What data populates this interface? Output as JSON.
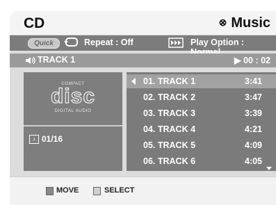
{
  "header": {
    "title": "CD",
    "mode": "Music",
    "mode_icon": "⊗"
  },
  "options": {
    "quick_label": "Quick",
    "repeat_text": "Repeat : Off",
    "play_option_text": "Play Option : Normal"
  },
  "status": {
    "current_track": "TRACK 1",
    "elapsed": "▶ 00 : 02"
  },
  "disc_logo": {
    "top": "COMPACT",
    "main": "disc",
    "bottom": "DIGITAL AUDIO"
  },
  "track_count": "01/16",
  "tracks": [
    {
      "name": "01. TRACK 1",
      "duration": "3:41"
    },
    {
      "name": "02. TRACK 2",
      "duration": "3:47"
    },
    {
      "name": "03. TRACK 3",
      "duration": "3:39"
    },
    {
      "name": "04. TRACK 4",
      "duration": "4:21"
    },
    {
      "name": "05. TRACK 5",
      "duration": "4:09"
    },
    {
      "name": "06. TRACK 6",
      "duration": "4:05"
    }
  ],
  "footer": {
    "move_label": "MOVE",
    "select_label": "SELECT"
  }
}
